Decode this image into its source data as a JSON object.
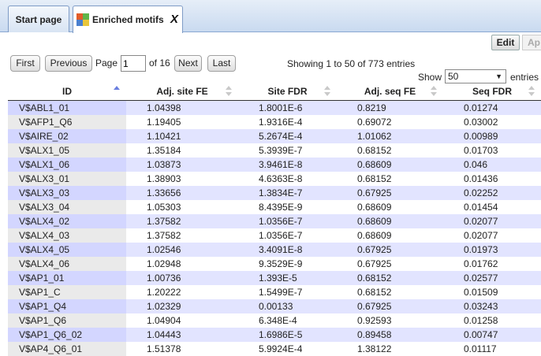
{
  "tabs": {
    "start_label": "Start page",
    "active_label": "Enriched motifs",
    "close_label": "X"
  },
  "toolbar": {
    "edit_label": "Edit",
    "ap_label": "Ap"
  },
  "pager": {
    "first_label": "First",
    "previous_label": "Previous",
    "page_label": "Page",
    "current_page": "1",
    "of_label": "of 16",
    "next_label": "Next",
    "last_label": "Last",
    "info_text": "Showing 1 to 50 of 773 entries",
    "show_label": "Show",
    "show_value": "50",
    "entries_label": "entries"
  },
  "table": {
    "columns": [
      "ID",
      "Adj. site FE",
      "Site FDR",
      "Adj. seq FE",
      "Seq FDR"
    ],
    "rows": [
      [
        "V$ABL1_01",
        "1.04398",
        "1.8001E-6",
        "0.8219",
        "0.01274"
      ],
      [
        "V$AFP1_Q6",
        "1.19405",
        "1.9316E-4",
        "0.69072",
        "0.03002"
      ],
      [
        "V$AIRE_02",
        "1.10421",
        "5.2674E-4",
        "1.01062",
        "0.00989"
      ],
      [
        "V$ALX1_05",
        "1.35184",
        "5.3939E-7",
        "0.68152",
        "0.01703"
      ],
      [
        "V$ALX1_06",
        "1.03873",
        "3.9461E-8",
        "0.68609",
        "0.046"
      ],
      [
        "V$ALX3_01",
        "1.38903",
        "4.6363E-8",
        "0.68152",
        "0.01436"
      ],
      [
        "V$ALX3_03",
        "1.33656",
        "1.3834E-7",
        "0.67925",
        "0.02252"
      ],
      [
        "V$ALX3_04",
        "1.05303",
        "8.4395E-9",
        "0.68609",
        "0.01454"
      ],
      [
        "V$ALX4_02",
        "1.37582",
        "1.0356E-7",
        "0.68609",
        "0.02077"
      ],
      [
        "V$ALX4_03",
        "1.37582",
        "1.0356E-7",
        "0.68609",
        "0.02077"
      ],
      [
        "V$ALX4_05",
        "1.02546",
        "3.4091E-8",
        "0.67925",
        "0.01973"
      ],
      [
        "V$ALX4_06",
        "1.02948",
        "9.3529E-9",
        "0.67925",
        "0.01762"
      ],
      [
        "V$AP1_01",
        "1.00736",
        "1.393E-5",
        "0.68152",
        "0.02577"
      ],
      [
        "V$AP1_C",
        "1.20222",
        "1.5499E-7",
        "0.68152",
        "0.01509"
      ],
      [
        "V$AP1_Q4",
        "1.02329",
        "0.00133",
        "0.67925",
        "0.03243"
      ],
      [
        "V$AP1_Q6",
        "1.04904",
        "6.348E-4",
        "0.92593",
        "0.01258"
      ],
      [
        "V$AP1_Q6_02",
        "1.04443",
        "1.6986E-5",
        "0.89458",
        "0.00747"
      ],
      [
        "V$AP4_Q6_01",
        "1.51378",
        "5.9924E-4",
        "1.38122",
        "0.01117"
      ]
    ]
  }
}
